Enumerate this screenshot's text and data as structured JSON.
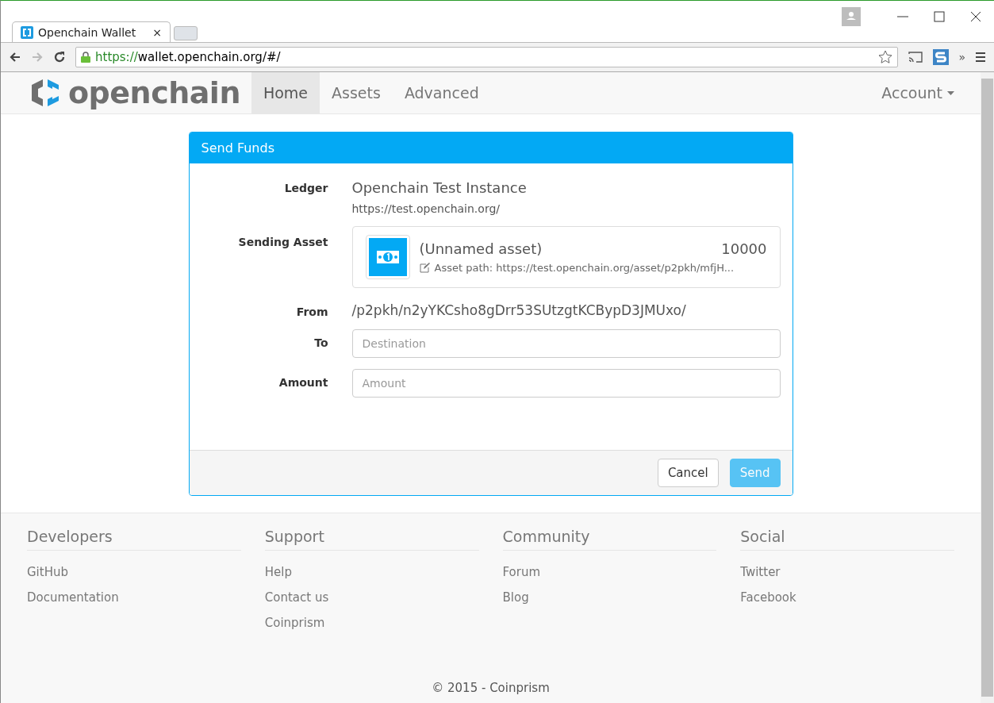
{
  "browser": {
    "tab_title": "Openchain Wallet",
    "tab_close": "×",
    "url_scheme": "https://",
    "url_rest": "wallet.openchain.org/#/",
    "overflow": "»"
  },
  "nav": {
    "logo": "openchain",
    "items": [
      {
        "label": "Home",
        "selected": true
      },
      {
        "label": "Assets",
        "selected": false
      },
      {
        "label": "Advanced",
        "selected": false
      }
    ],
    "account": "Account"
  },
  "panel": {
    "title": "Send Funds",
    "ledger": {
      "label": "Ledger",
      "name": "Openchain Test Instance",
      "url": "https://test.openchain.org/"
    },
    "asset": {
      "label": "Sending Asset",
      "name": "(Unnamed asset)",
      "amount": "10000",
      "path": "Asset path: https://test.openchain.org/asset/p2pkh/mfjH..."
    },
    "from": {
      "label": "From",
      "value": "/p2pkh/n2yYKCsho8gDrr53SUtzgtKCBypD3JMUxo/"
    },
    "fields": [
      {
        "label": "To",
        "placeholder": "Destination"
      },
      {
        "label": "Amount",
        "placeholder": "Amount"
      }
    ],
    "cancel": "Cancel",
    "send": {
      "label": "Send",
      "disabled": true
    }
  },
  "footer": {
    "columns": [
      {
        "title": "Developers",
        "links": [
          "GitHub",
          "Documentation"
        ]
      },
      {
        "title": "Support",
        "links": [
          "Help",
          "Contact us",
          "Coinprism"
        ]
      },
      {
        "title": "Community",
        "links": [
          "Forum",
          "Blog"
        ]
      },
      {
        "title": "Social",
        "links": [
          "Twitter",
          "Facebook"
        ]
      }
    ],
    "copyright": "© 2015 - Coinprism"
  }
}
